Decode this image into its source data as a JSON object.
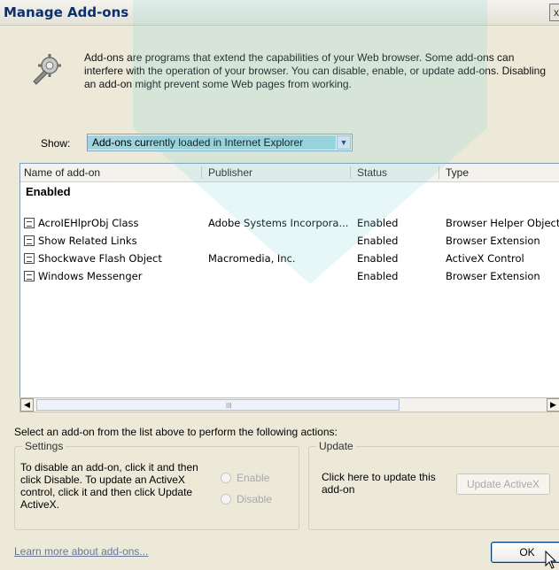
{
  "window": {
    "title": "Manage Add-ons",
    "close_glyph": "x"
  },
  "description": "Add-ons are programs that extend the capabilities of your Web browser. Some add-ons can interfere with the operation of your browser. You can disable, enable, or update add-ons. Disabling an add-on might prevent some Web pages from working.",
  "icons": {
    "header": "gear-wrench-icon",
    "addon": "window-icon",
    "cursor": "mouse-pointer-icon"
  },
  "show": {
    "label": "Show:",
    "selected": "Add-ons currently loaded in Internet Explorer"
  },
  "list": {
    "columns": [
      "Name of add-on",
      "Publisher",
      "Status",
      "Type"
    ],
    "group": "Enabled",
    "rows": [
      {
        "name": "AcroIEHlprObj Class",
        "publisher": "Adobe Systems Incorpora...",
        "status": "Enabled",
        "type": "Browser Helper Object"
      },
      {
        "name": "Show Related Links",
        "publisher": "",
        "status": "Enabled",
        "type": "Browser Extension"
      },
      {
        "name": "Shockwave Flash Object",
        "publisher": "Macromedia, Inc.",
        "status": "Enabled",
        "type": "ActiveX Control"
      },
      {
        "name": "Windows Messenger",
        "publisher": "",
        "status": "Enabled",
        "type": "Browser Extension"
      }
    ]
  },
  "instructions": "Select an add-on from the list above to perform the following actions:",
  "settings": {
    "legend": "Settings",
    "text": "To disable an add-on, click it and then click Disable. To update an ActiveX control, click it and then click Update ActiveX.",
    "enable_label": "Enable",
    "disable_label": "Disable"
  },
  "update": {
    "legend": "Update",
    "text": "Click here to update this add-on",
    "button_label": "Update ActiveX"
  },
  "learn_more": "Learn more about add-ons...",
  "ok_label": "OK",
  "colors": {
    "accent": "#0b2f6f",
    "selection": "#9fd3de",
    "border": "#7f9db9"
  }
}
